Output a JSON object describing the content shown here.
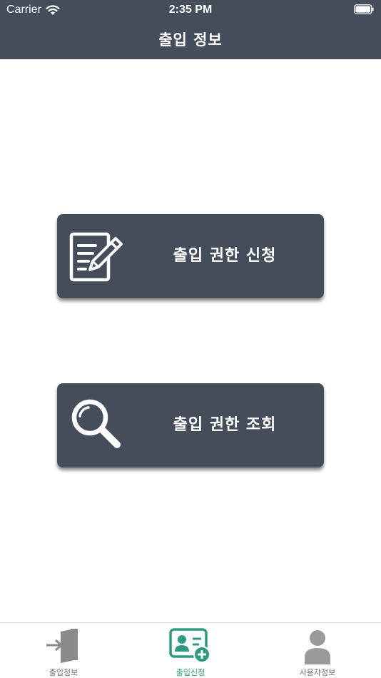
{
  "status_bar": {
    "carrier": "Carrier",
    "time": "2:35 PM"
  },
  "header": {
    "title": "출입 정보"
  },
  "actions": [
    {
      "label": "출입 권한 신청",
      "icon": "edit-document-icon"
    },
    {
      "label": "출입 권한 조회",
      "icon": "search-icon"
    }
  ],
  "tabs": [
    {
      "label": "출입정보",
      "icon": "door-enter-icon",
      "active": false
    },
    {
      "label": "출입신청",
      "icon": "id-card-add-icon",
      "active": true
    },
    {
      "label": "사용자정보",
      "icon": "user-icon",
      "active": false
    }
  ],
  "colors": {
    "bar": "#454d5a",
    "accent": "#2e9a82",
    "inactive": "#707070"
  }
}
